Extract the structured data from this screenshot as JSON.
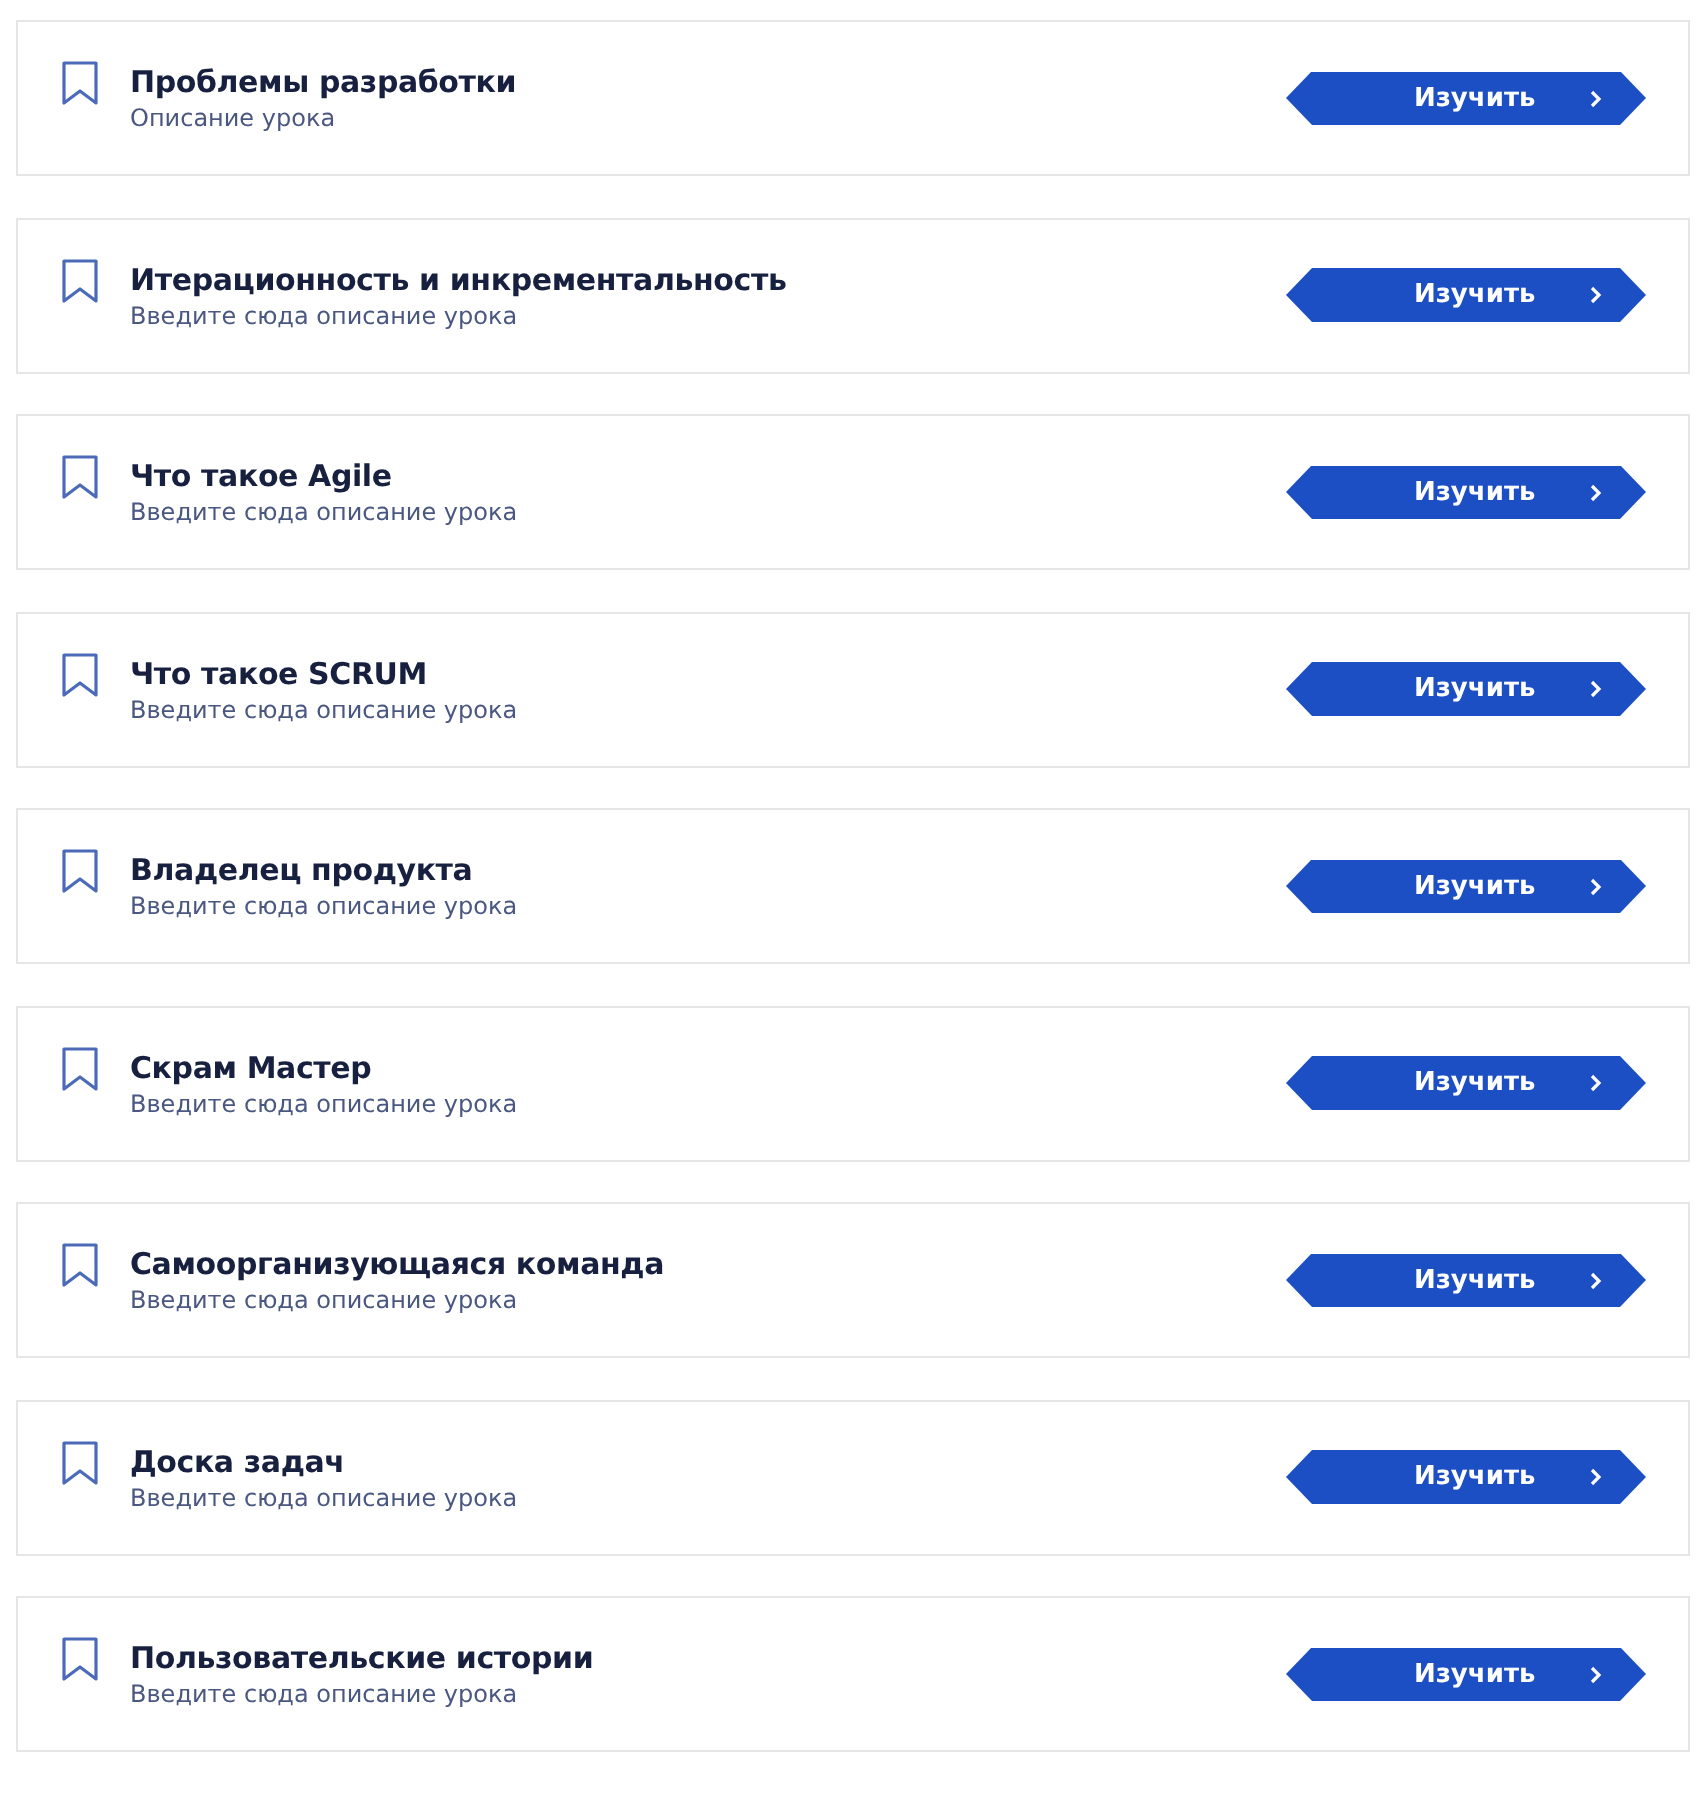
{
  "lessons": [
    {
      "title": "Проблемы разработки",
      "description": "Описание урока",
      "button": "Изучить"
    },
    {
      "title": "Итерационность и инкрементальность",
      "description": "Введите сюда описание урока",
      "button": "Изучить"
    },
    {
      "title": "Что такое Agile",
      "description": "Введите сюда описание урока",
      "button": "Изучить"
    },
    {
      "title": "Что такое SCRUM",
      "description": "Введите сюда описание урока",
      "button": "Изучить"
    },
    {
      "title": "Владелец продукта",
      "description": "Введите сюда описание урока",
      "button": "Изучить"
    },
    {
      "title": "Скрам Мастер",
      "description": "Введите сюда описание урока",
      "button": "Изучить"
    },
    {
      "title": "Самоорганизующаяся команда",
      "description": "Введите сюда описание урока",
      "button": "Изучить"
    },
    {
      "title": "Доска задач",
      "description": "Введите сюда описание урока",
      "button": "Изучить"
    },
    {
      "title": "Пользовательские истории",
      "description": "Введите сюда описание урока",
      "button": "Изучить"
    }
  ]
}
